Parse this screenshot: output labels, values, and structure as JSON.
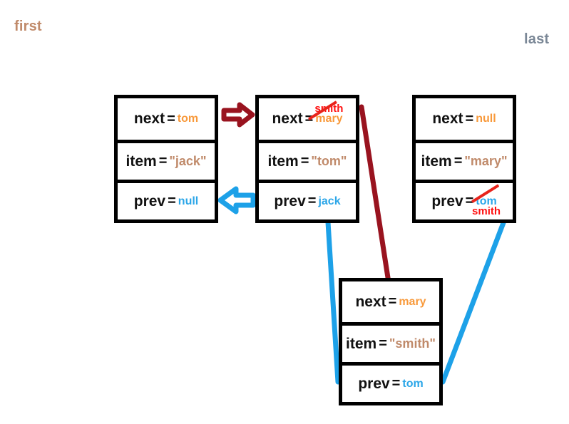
{
  "diagram": {
    "title_labels": {
      "first": "first",
      "last": "last"
    },
    "field_names": {
      "next": "next",
      "item": "item",
      "prev": "prev"
    },
    "equals": "=",
    "colors": {
      "next_value": "#F89A3C",
      "item_value": "#C08A6A",
      "prev_value": "#2BA6E8",
      "annotation_red": "#FF1111",
      "strike_red": "#E8231B",
      "next_arrow": "#99131F",
      "prev_arrow": "#1DA1E8",
      "box_border": "#000000",
      "first_label": "#C08A6A",
      "last_label": "#7A8796"
    },
    "nodes": [
      {
        "id": "node-jack",
        "next": "tom",
        "item": "\"jack\"",
        "prev": "null",
        "next_annotation": null,
        "prev_annotation": null,
        "next_struck": false,
        "prev_struck": false
      },
      {
        "id": "node-tom",
        "next": "mary",
        "item": "\"tom\"",
        "prev": "jack",
        "next_annotation": "smith",
        "prev_annotation": null,
        "next_struck": true,
        "prev_struck": false
      },
      {
        "id": "node-mary",
        "next": "null",
        "item": "\"mary\"",
        "prev": "tom",
        "next_annotation": null,
        "prev_annotation": "smith",
        "next_struck": false,
        "prev_struck": true
      },
      {
        "id": "node-smith",
        "next": "mary",
        "item": "\"smith\"",
        "prev": "tom",
        "next_annotation": null,
        "prev_annotation": null,
        "next_struck": false,
        "prev_struck": false
      }
    ],
    "connectors": [
      {
        "name": "next-arrow-jack-to-tom",
        "kind": "block-arrow",
        "direction": "right",
        "color": "#99131F"
      },
      {
        "name": "prev-arrow-tom-to-jack",
        "kind": "block-arrow",
        "direction": "left",
        "color": "#1DA1E8"
      },
      {
        "name": "next-line-tom-to-smith",
        "kind": "line",
        "color": "#99131F"
      },
      {
        "name": "prev-line-smith-to-tom",
        "kind": "line",
        "color": "#1DA1E8"
      },
      {
        "name": "prev-line-mary-to-smith",
        "kind": "line",
        "color": "#1DA1E8"
      }
    ]
  }
}
